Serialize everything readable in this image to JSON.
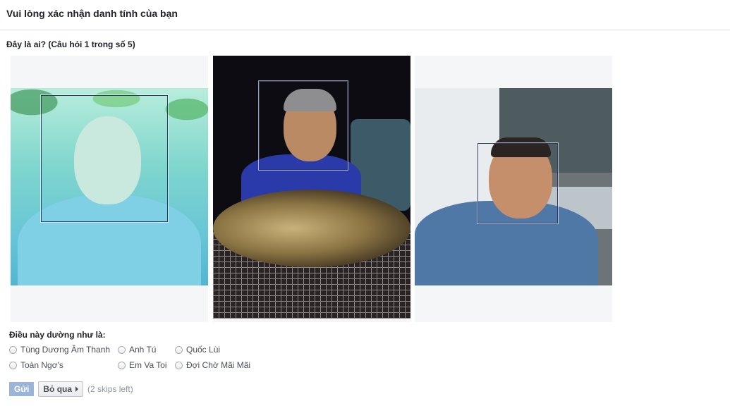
{
  "header": {
    "title": "Vui lòng xác nhận danh tính của bạn"
  },
  "question": {
    "text": "Đây là ai? (Câu hỏi 1 trong số 5)"
  },
  "photos": [
    {
      "label": "photo-1"
    },
    {
      "label": "photo-2"
    },
    {
      "label": "photo-3"
    }
  ],
  "answers": {
    "prompt": "Điều này dường như là:",
    "options": [
      "Tùng Dương Âm Thanh",
      "Anh Tú",
      "Quốc Lùi",
      "Toàn Ngơ's",
      "Em Va Toi",
      "Đợi Chờ Mãi Mãi"
    ]
  },
  "actions": {
    "send_label": "Gửi",
    "skip_label": "Bỏ qua",
    "skips_left": "(2 skips left)"
  },
  "colors": {
    "send_button": "#9cb4d8",
    "face_box": "#2b3a6a",
    "divider": "#dddfe2"
  }
}
